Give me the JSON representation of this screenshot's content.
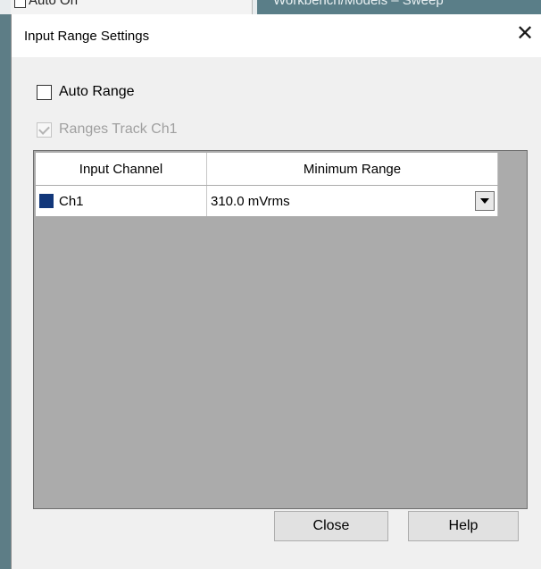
{
  "background": {
    "left_label": "Auto On",
    "right_label": "Workbench/Models – Sweep"
  },
  "dialog": {
    "title": "Input Range Settings",
    "close_glyph": "✕"
  },
  "options": {
    "auto_range": {
      "label": "Auto Range",
      "checked": false
    },
    "ranges_track": {
      "label": "Ranges Track Ch1",
      "checked": true,
      "disabled": true
    }
  },
  "grid": {
    "headers": [
      "Input Channel",
      "Minimum Range"
    ],
    "rows": [
      {
        "channel": "Ch1",
        "color": "#12377a",
        "minimum_range": "310.0 mVrms"
      }
    ]
  },
  "buttons": {
    "close_label": "Close",
    "help_label": "Help"
  }
}
